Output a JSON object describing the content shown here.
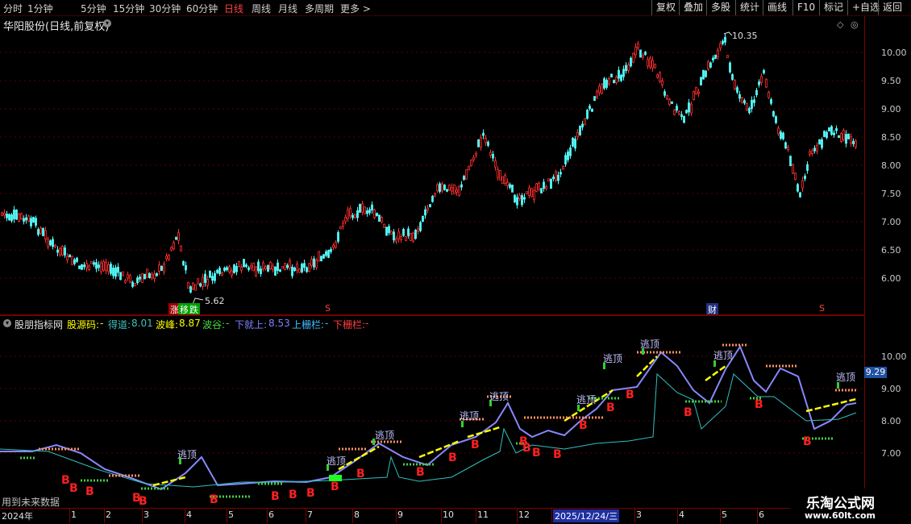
{
  "toolbar": {
    "periods": [
      "分时",
      "1分钟",
      "5分钟",
      "15分钟",
      "30分钟",
      "60分钟",
      "日线",
      "周线",
      "月线",
      "多周期",
      "更多 >"
    ],
    "actions": [
      "复权",
      "叠加",
      "多股",
      "统计",
      "画线",
      "F10",
      "标记",
      "+自选",
      "返回"
    ]
  },
  "main_panel": {
    "title": "华阳股份(日线,前复权)",
    "price_axis": [
      "10.00",
      "9.50",
      "9.00",
      "8.50",
      "8.00",
      "7.50",
      "7.00",
      "6.50",
      "6.00"
    ],
    "high_label": "10.35",
    "low_label": "5.62",
    "markers": [
      "涨",
      "移",
      "跌",
      "S",
      "财",
      "S"
    ]
  },
  "indicator_panel": {
    "name": "股朋指标网",
    "items": [
      {
        "label": "股源码:",
        "value": "-",
        "color": "#ffff00"
      },
      {
        "label": "得道:",
        "value": "8.01",
        "color": "#40c0c0"
      },
      {
        "label": "波峰:",
        "value": "8.87",
        "color": "#ffff00"
      },
      {
        "label": "波谷:",
        "value": "-",
        "color": "#40e040"
      },
      {
        "label": "下就上:",
        "value": "8.53",
        "color": "#8080ff"
      },
      {
        "label": "上栅栏:",
        "value": "-",
        "color": "#40c0ff"
      },
      {
        "label": "下栅栏:",
        "value": "-",
        "color": "#ff4040"
      }
    ],
    "axis": [
      "10.00",
      "9.00",
      "8.00",
      "7.00"
    ],
    "current_value": "9.29",
    "escape_label": "逃顶",
    "buy_label": "B",
    "footnote": "用到未来数据"
  },
  "time_axis": {
    "labels": [
      "2024年",
      "1",
      "2",
      "3",
      "4",
      "5",
      "6",
      "7",
      "8",
      "9",
      "10",
      "11",
      "12",
      "2025/12/24/三",
      "3",
      "4",
      "5",
      "6"
    ]
  },
  "watermark": {
    "title": "乐淘公式网",
    "url": "www.60lt.com"
  },
  "colors": {
    "up": "#ff3030",
    "down": "#54fcfc",
    "accent": "#7a0000",
    "bg": "#000000"
  }
}
